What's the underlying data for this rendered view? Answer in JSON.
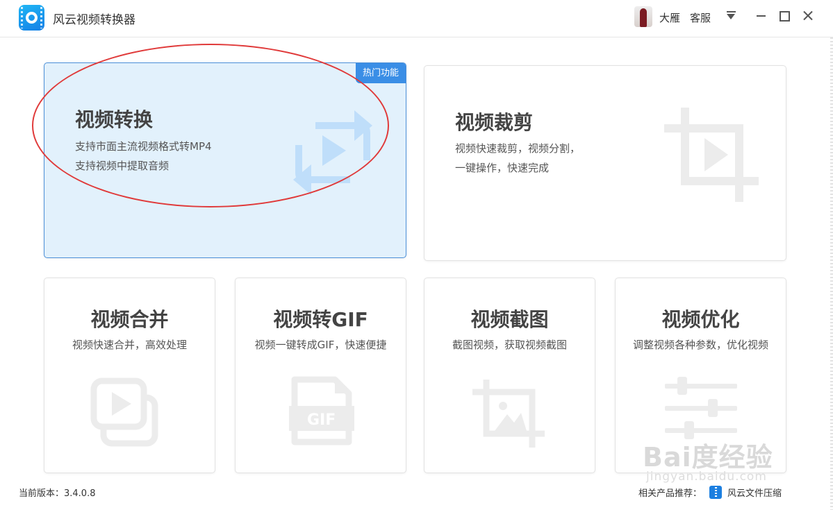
{
  "app": {
    "title": "风云视频转换器",
    "logo_icon": "app-logo-icon"
  },
  "header": {
    "user_name": "大雁",
    "service_label": "客服",
    "menu_icon": "dropdown-menu-icon",
    "minimize_icon": "minimize-icon",
    "maximize_icon": "maximize-icon",
    "close_icon": "close-icon"
  },
  "cards": {
    "convert": {
      "title": "视频转换",
      "line1": "支持市面主流视频格式转MP4",
      "line2": "支持视频中提取音频",
      "badge": "热门功能",
      "icon": "convert-icon"
    },
    "trim": {
      "title": "视频裁剪",
      "line1": "视频快速裁剪，视频分割，",
      "line2": "一键操作，快速完成",
      "icon": "crop-video-icon"
    },
    "merge": {
      "title": "视频合并",
      "desc": "视频快速合并，高效处理",
      "icon": "merge-video-icon"
    },
    "gif": {
      "title": "视频转GIF",
      "desc": "视频一键转成GIF，快速便捷",
      "icon": "gif-file-icon",
      "icon_text": "GIF"
    },
    "screenshot": {
      "title": "视频截图",
      "desc": "截图视频，获取视频截图",
      "icon": "screenshot-image-icon"
    },
    "optimize": {
      "title": "视频优化",
      "desc": "调整视频各种参数，优化视频",
      "icon": "sliders-icon"
    }
  },
  "footer": {
    "version_label": "当前版本：3.4.0.8",
    "related_label": "相关产品推荐：",
    "related_product": "风云文件压缩",
    "related_icon": "zip-file-icon"
  },
  "watermark": {
    "text": "Bai度经验",
    "sub": "jingyan.baidu.com"
  },
  "colors": {
    "accent": "#3a8ee6",
    "active_card_bg": "#e2f1fc",
    "annotation": "#e03a3a",
    "icon_blue": "#bfdefa",
    "icon_gray": "#ececec"
  }
}
